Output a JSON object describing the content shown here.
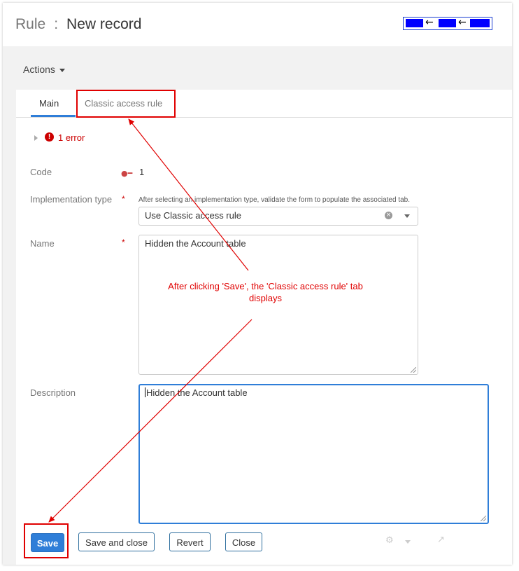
{
  "header": {
    "entity": "Rule",
    "separator": ":",
    "record_title": "New record",
    "nav_widget": {
      "prev_arrow": "←",
      "next_arrow": "←"
    }
  },
  "toolbar": {
    "actions_label": "Actions"
  },
  "tabs": [
    {
      "label": "Main",
      "active": true
    },
    {
      "label": "Classic access rule",
      "active": false
    }
  ],
  "errors": {
    "summary": "1 error",
    "icon": "!"
  },
  "form": {
    "code": {
      "label": "Code",
      "value": "1",
      "icon": "key-icon"
    },
    "implementation_type": {
      "label": "Implementation type",
      "required_mark": "*",
      "hint": "After selecting an implementation type, validate the form to populate the associated tab.",
      "value": "Use Classic access rule",
      "clear_glyph": "×"
    },
    "name": {
      "label": "Name",
      "required_mark": "*",
      "value": "Hidden the Account table"
    },
    "description": {
      "label": "Description",
      "value": "Hidden the Account table"
    }
  },
  "footer": {
    "save_label": "Save",
    "save_close_label": "Save and close",
    "revert_label": "Revert",
    "close_label": "Close"
  },
  "annotation": {
    "text": "After clicking 'Save', the 'Classic access rule' tab displays",
    "color": "#e00000"
  },
  "colors": {
    "accent": "#2f7ed8",
    "error": "#cc0000",
    "annotation": "#e00000",
    "nav_widget": "#0000ff"
  }
}
